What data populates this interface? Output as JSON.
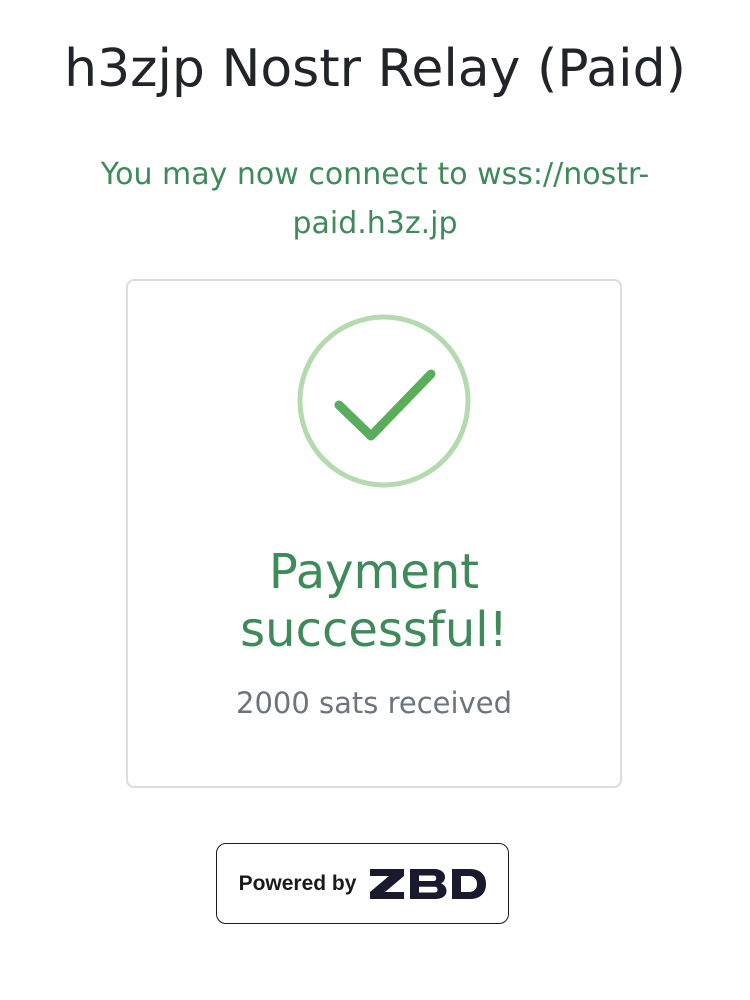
{
  "header": {
    "title": "h3zjp Nostr Relay (Paid)"
  },
  "notice": {
    "connect_message": "You may now connect to wss://nostr-paid.h3z.jp"
  },
  "payment": {
    "status_icon": "checkmark-circle-icon",
    "status_title": "Payment successful!",
    "amount_text": "2000 sats received"
  },
  "footer": {
    "powered_by_label": "Powered by",
    "brand_logo_text": "ZBD"
  },
  "colors": {
    "success_green": "#3f8a5a",
    "check_stroke": "#5aad5a",
    "ring_light_green": "#b5dab0",
    "muted_gray": "#6c757d"
  }
}
